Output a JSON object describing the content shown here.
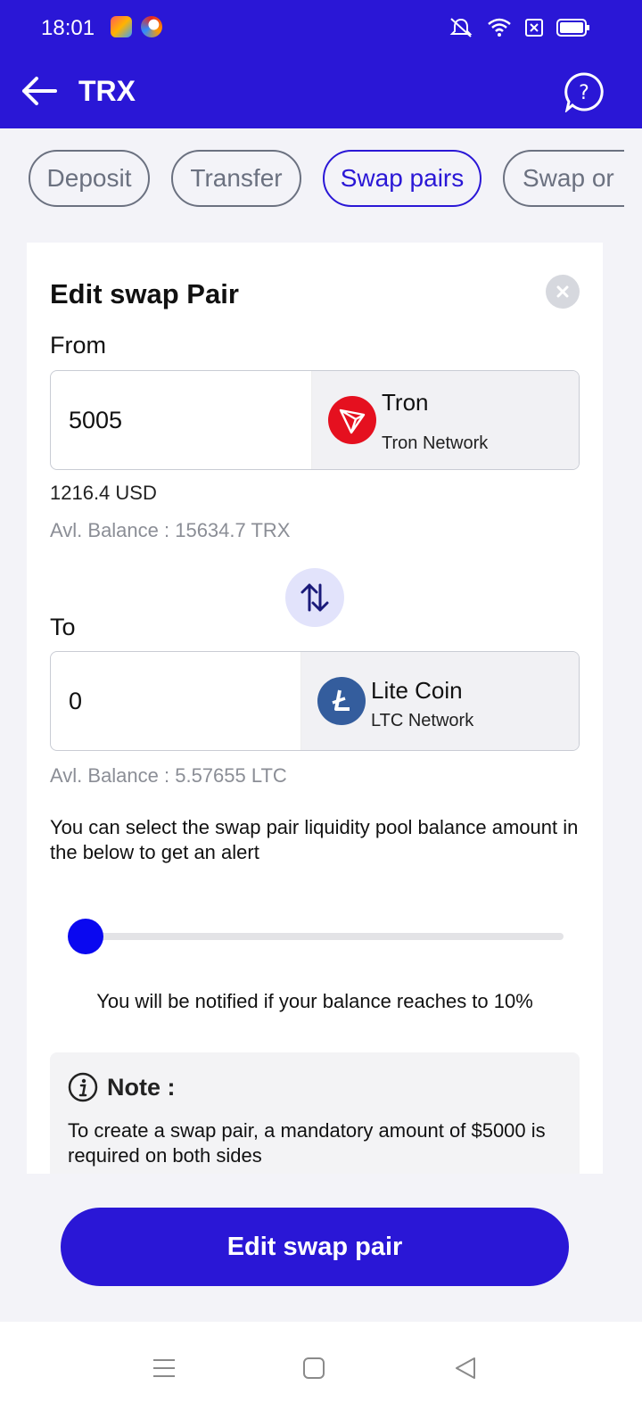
{
  "status_bar": {
    "time": "18:01"
  },
  "header": {
    "title": "TRX"
  },
  "tabs": [
    {
      "label": "Deposit",
      "active": false
    },
    {
      "label": "Transfer",
      "active": false
    },
    {
      "label": "Swap pairs",
      "active": true
    },
    {
      "label": "Swap or",
      "active": false
    }
  ],
  "card": {
    "title": "Edit swap Pair",
    "from": {
      "label": "From",
      "amount": "5005",
      "coin_name": "Tron",
      "network": "Tron Network",
      "usd_value": "1216.4 USD",
      "balance": "Avl. Balance : 15634.7 TRX"
    },
    "to": {
      "label": "To",
      "amount": "0",
      "coin_name": "Lite Coin",
      "network": "LTC Network",
      "balance": "Avl. Balance : 5.57655 LTC"
    },
    "description": "You can select the swap pair liquidity pool balance amount in the below to get an alert",
    "slider_percent": 10,
    "notify_text": "You will be notified if your balance reaches to 10%",
    "note": {
      "title": "Note :",
      "text": "To create a swap pair, a mandatory amount of $5000 is required on both sides"
    }
  },
  "primary_button": {
    "label": "Edit swap pair"
  },
  "colors": {
    "primary": "#2a17d6",
    "tron_red": "#e5101f",
    "ltc_blue": "#345d9d"
  }
}
